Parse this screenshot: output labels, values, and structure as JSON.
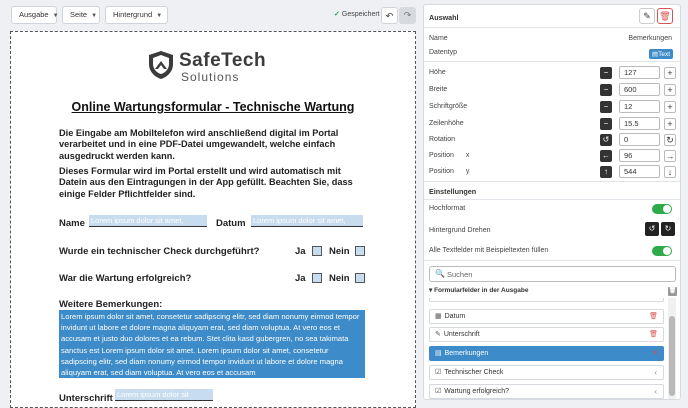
{
  "toolbar": {
    "output_label": "Ausgabe",
    "page_label": "Seite",
    "background_label": "Hintergrund",
    "saved_label": "Gespeichert",
    "undo_icon": "undo-icon",
    "redo_icon": "redo-icon"
  },
  "document": {
    "logo_name": "SafeTech",
    "logo_sub": "Solutions",
    "title": "Online Wartungsformular - Technische Wartung",
    "paragraph1": "Die Eingabe am Mobiltelefon wird anschließend digital im Portal verarbeitet und in eine PDF-Datei umgewandelt, welche einfach ausgedruckt werden kann.",
    "paragraph2": "Dieses Formular wird im Portal erstellt und wird automatisch mit Datein aus den Eintragungen in der App gefüllt. Beachten Sie, dass einige Felder Pflichtfelder sind.",
    "name_label": "Name",
    "name_value": "Lorem ipsum dolor sit amet,",
    "date_label": "Datum",
    "date_value": "Lorem ipsum dolor sit amet,",
    "q1": "Wurde ein technischer Check durchgeführt?",
    "q2": "War die Wartung erfolgreich?",
    "yes": "Ja",
    "no": "Nein",
    "remarks_label": "Weitere Bemerkungen:",
    "remarks_value": "Lorem ipsum dolor sit amet, consetetur sadipscing elitr, sed diam nonumy eirmod tempor invidunt ut labore et dolore magna aliquyam erat, sed diam voluptua. At vero eos et accusam et justo duo dolores et ea rebum. Stet clita kasd gubergren, no sea takimata sanctus est Lorem ipsum dolor sit amet. Lorem ipsum dolor sit amet, consetetur sadipscing elitr, sed diam nonumy eirmod tempor invidunt ut labore et dolore magna aliquyam erat, sed diam voluptua. At vero eos et accusam",
    "signature_label": "Unterschrift",
    "signature_value": "Lorem ipsum dolor sit"
  },
  "selection": {
    "heading": "Auswahl",
    "name_label": "Name",
    "name_value": "Bemerkungen",
    "type_label": "Datentyp",
    "type_value": "Text",
    "props": [
      {
        "label": "Höhe",
        "value": "127"
      },
      {
        "label": "Breite",
        "value": "600"
      },
      {
        "label": "Schriftgröße",
        "value": "12"
      },
      {
        "label": "Zeilenhöhe",
        "value": "15.5"
      },
      {
        "label": "Rotation",
        "value": "0"
      }
    ],
    "position_label": "Position",
    "x_label": "x",
    "x_value": "96",
    "y_label": "y",
    "y_value": "544"
  },
  "settings": {
    "heading": "Einstellungen",
    "portrait_label": "Hochformat",
    "portrait_on": true,
    "rotate_bg_label": "Hintergrund Drehen",
    "fill_label": "Alle Textfelder mit Beispieltexten füllen",
    "fill_on": true
  },
  "fields": {
    "search_placeholder": "Suchen",
    "group_label": "Formularfelder in der Ausgabe",
    "items": [
      {
        "label": "Datum",
        "icon": "calendar-icon",
        "action": "trash"
      },
      {
        "label": "Unterschrift",
        "icon": "edit-icon",
        "action": "trash"
      },
      {
        "label": "Bemerkungen",
        "icon": "text-icon",
        "action": "close",
        "active": true
      },
      {
        "label": "Technischer Check",
        "icon": "checkbox-icon",
        "action": "chevron"
      },
      {
        "label": "Wartung erfolgreich?",
        "icon": "checkbox-icon",
        "action": "chevron"
      }
    ]
  },
  "colors": {
    "accent": "#3d8bc8",
    "field_fill": "#c7dcee",
    "toggle_on": "#2eaa4a",
    "danger": "#d9534f"
  }
}
